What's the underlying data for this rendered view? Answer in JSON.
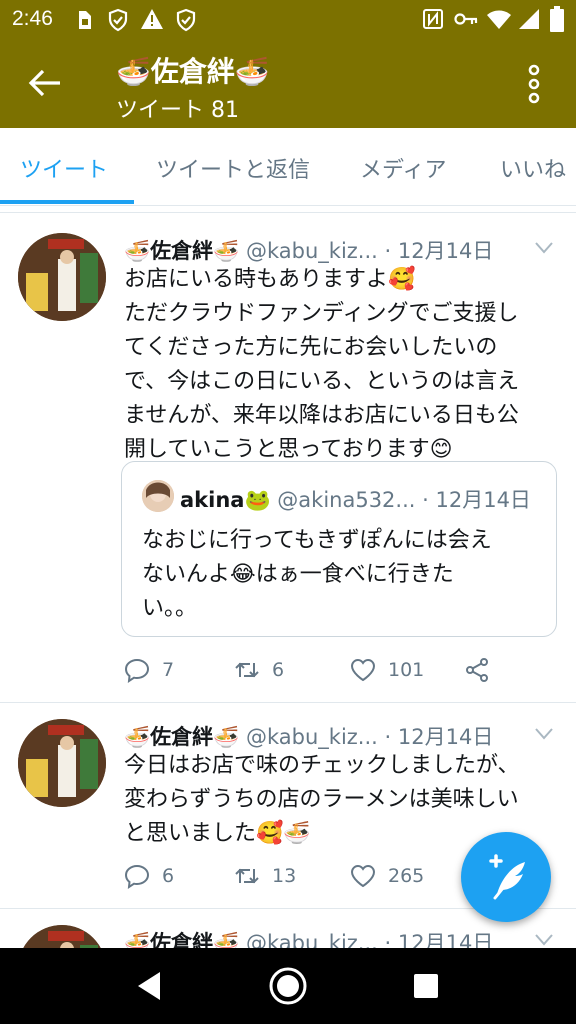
{
  "status_bar": {
    "time": "2:46",
    "icons": [
      "sim-icon",
      "shield-check-icon",
      "warning-icon",
      "shield-icon",
      "nfc-icon",
      "key-icon",
      "wifi-icon",
      "signal-icon",
      "battery-icon"
    ]
  },
  "app_bar": {
    "title": "🍜佐倉絆🍜",
    "subtitle": "ツイート 81",
    "background": "#7c7100"
  },
  "tabs": [
    {
      "label": "ツイート",
      "active": true
    },
    {
      "label": "ツイートと返信",
      "active": false
    },
    {
      "label": "メディア",
      "active": false
    },
    {
      "label": "いいね",
      "active": false
    }
  ],
  "tweets": [
    {
      "name": "🍜佐倉絆🍜",
      "handle": "@kabu_kiz...",
      "date": "· 12月14日",
      "lines": [
        "お店にいる時もありますよ🥰",
        "ただクラウドファンディングでご支援し",
        "てくださった方に先にお会いしたいの",
        "で、今はこの日にいる、というのは言え",
        "ませんが、来年以降はお店にいる日も公",
        "開していこうと思っております😊"
      ],
      "quote": {
        "name": "akina🐸",
        "handle": "@akina532...",
        "date": "· 12月14日",
        "lines": [
          "なおじに行ってもきずぽんには会え",
          "ないんよ😂はぁ一食べに行きた",
          "い。。"
        ]
      },
      "replies": "7",
      "retweets": "6",
      "likes": "101"
    },
    {
      "name": "🍜佐倉絆🍜",
      "handle": "@kabu_kiz...",
      "date": "· 12月14日",
      "lines": [
        "今日はお店で味のチェックしましたが、",
        "変わらずうちの店のラーメンは美味しい",
        "と思いました🥰🍜"
      ],
      "replies": "6",
      "retweets": "13",
      "likes": "265"
    },
    {
      "name": "🍜佐倉絆🍜",
      "handle": "@kabu_kiz...",
      "date": "· 12月14日"
    }
  ],
  "accent_color": "#1da1f2"
}
